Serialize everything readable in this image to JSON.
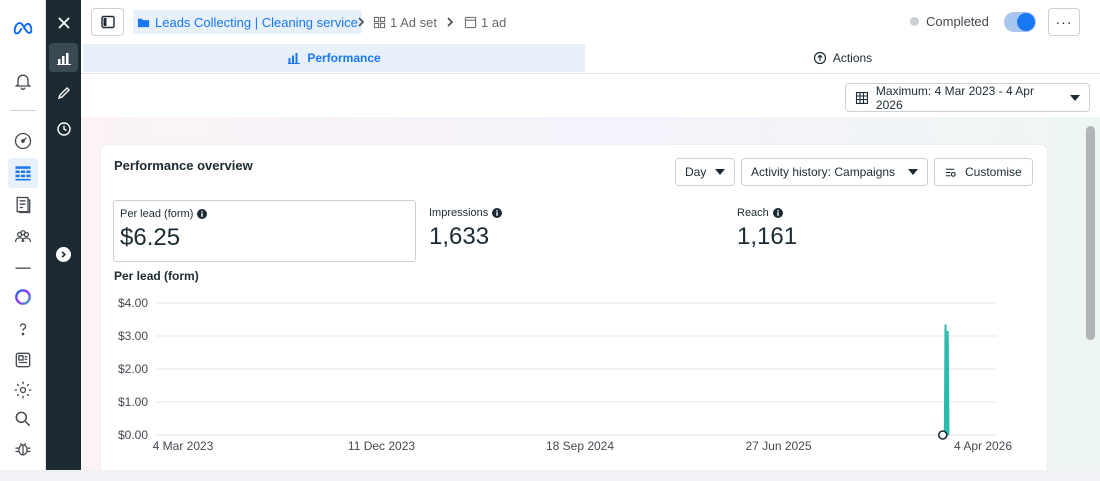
{
  "left_rail": {
    "items": [
      "meta-logo-icon",
      "bell-icon",
      "gauge-icon",
      "table-icon",
      "pages-icon",
      "audience-icon",
      "divider-icon",
      "ring-icon",
      "help-icon",
      "news-icon",
      "gear-icon",
      "search-icon",
      "bug-icon"
    ]
  },
  "side_panel": {
    "items": [
      "close-icon",
      "performance-icon",
      "edit-icon",
      "history-icon",
      "expand-icon"
    ]
  },
  "breadcrumb": {
    "campaign": "Leads Collecting | Cleaning service",
    "adset": "1 Ad set",
    "ad": "1 ad"
  },
  "status": {
    "label": "Completed",
    "toggle_on": true
  },
  "tabs": {
    "performance": "Performance",
    "actions": "Actions"
  },
  "date_range": {
    "label": "Maximum: 4 Mar 2023 - 4 Apr 2026"
  },
  "overview": {
    "title": "Performance overview",
    "granularity": "Day",
    "activity": "Activity history: Campaigns",
    "customise": "Customise"
  },
  "metrics": [
    {
      "label": "Per lead (form)",
      "value": "$6.25",
      "selected": true
    },
    {
      "label": "Impressions",
      "value": "1,633",
      "selected": false
    },
    {
      "label": "Reach",
      "value": "1,161",
      "selected": false
    }
  ],
  "chart_data": {
    "type": "line",
    "title": "Per lead (form)",
    "xlabel": "",
    "ylabel": "",
    "x_ticks": [
      "4 Mar 2023",
      "11 Dec 2023",
      "18 Sep 2024",
      "27 Jun 2025",
      "4 Apr 2026"
    ],
    "y_ticks": [
      "$0.00",
      "$1.00",
      "$2.00",
      "$3.00",
      "$4.00"
    ],
    "ylim": [
      0,
      4
    ],
    "xlim": [
      "2023-03-04",
      "2026-04-04"
    ],
    "grid": true,
    "series": [
      {
        "color": "#2abbb0",
        "points": [
          [
            "2026-01-24",
            0.0
          ],
          [
            "2026-01-25",
            3.35
          ],
          [
            "2026-01-26",
            0.0
          ],
          [
            "2026-01-27",
            0.0
          ],
          [
            "2026-01-28",
            3.15
          ],
          [
            "2026-01-29",
            0.0
          ]
        ]
      }
    ]
  }
}
